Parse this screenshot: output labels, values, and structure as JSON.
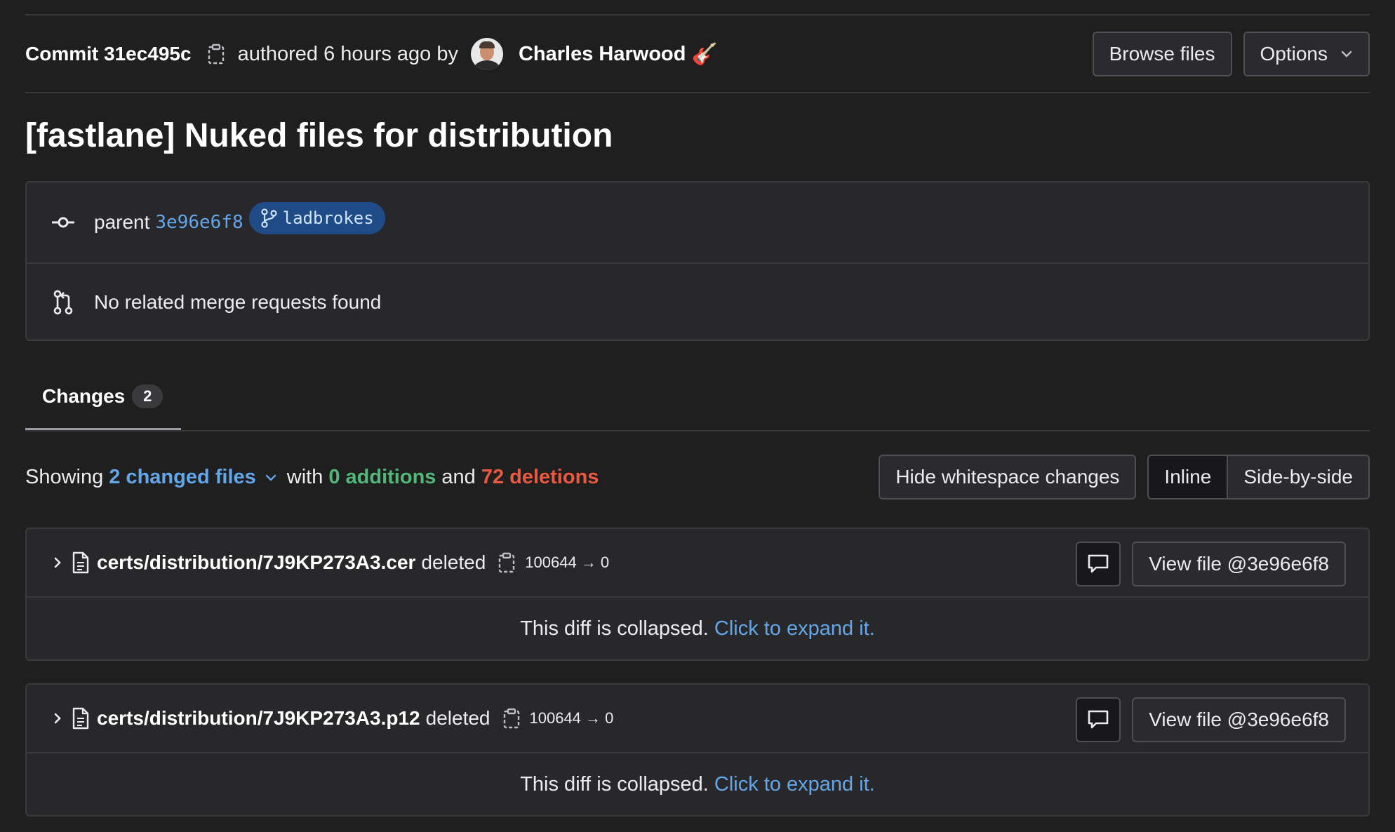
{
  "commit": {
    "label": "Commit 31ec495c",
    "authored_text": "authored 6 hours ago by",
    "author": "Charles Harwood",
    "author_emoji": "🎸",
    "browse_files": "Browse files",
    "options": "Options",
    "title": "[fastlane] Nuked files for distribution"
  },
  "info": {
    "parent_label": "parent",
    "parent_sha": "3e96e6f8",
    "branch": "ladbrokes",
    "merge_requests": "No related merge requests found"
  },
  "tabs": [
    {
      "label": "Changes",
      "count": "2"
    }
  ],
  "summary": {
    "showing": "Showing",
    "changed_files": "2 changed files",
    "with": "with",
    "additions": "0 additions",
    "and": "and",
    "deletions": "72 deletions"
  },
  "controls": {
    "hide_whitespace": "Hide whitespace changes",
    "inline": "Inline",
    "side_by_side": "Side-by-side"
  },
  "files": [
    {
      "path": "certs/distribution/7J9KP273A3.cer",
      "status": "deleted",
      "mode": "100644 → 0",
      "view_file": "View file @3e96e6f8",
      "collapsed_text": "This diff is collapsed.",
      "expand_link": "Click to expand it."
    },
    {
      "path": "certs/distribution/7J9KP273A3.p12",
      "status": "deleted",
      "mode": "100644 → 0",
      "view_file": "View file @3e96e6f8",
      "collapsed_text": "This diff is collapsed.",
      "expand_link": "Click to expand it."
    }
  ],
  "colors": {
    "link": "#63a6e9",
    "additions": "#52b87a",
    "deletions": "#ec5941",
    "branch_badge_bg": "#1f4b86"
  },
  "icons": {
    "copy": "clipboard-icon",
    "commit": "commit-icon",
    "branch": "branch-icon",
    "merge_request": "merge-request-icon",
    "file": "file-icon",
    "comment": "comment-icon",
    "chevron_down": "chevron-down-icon",
    "chevron_right": "chevron-right-icon"
  }
}
